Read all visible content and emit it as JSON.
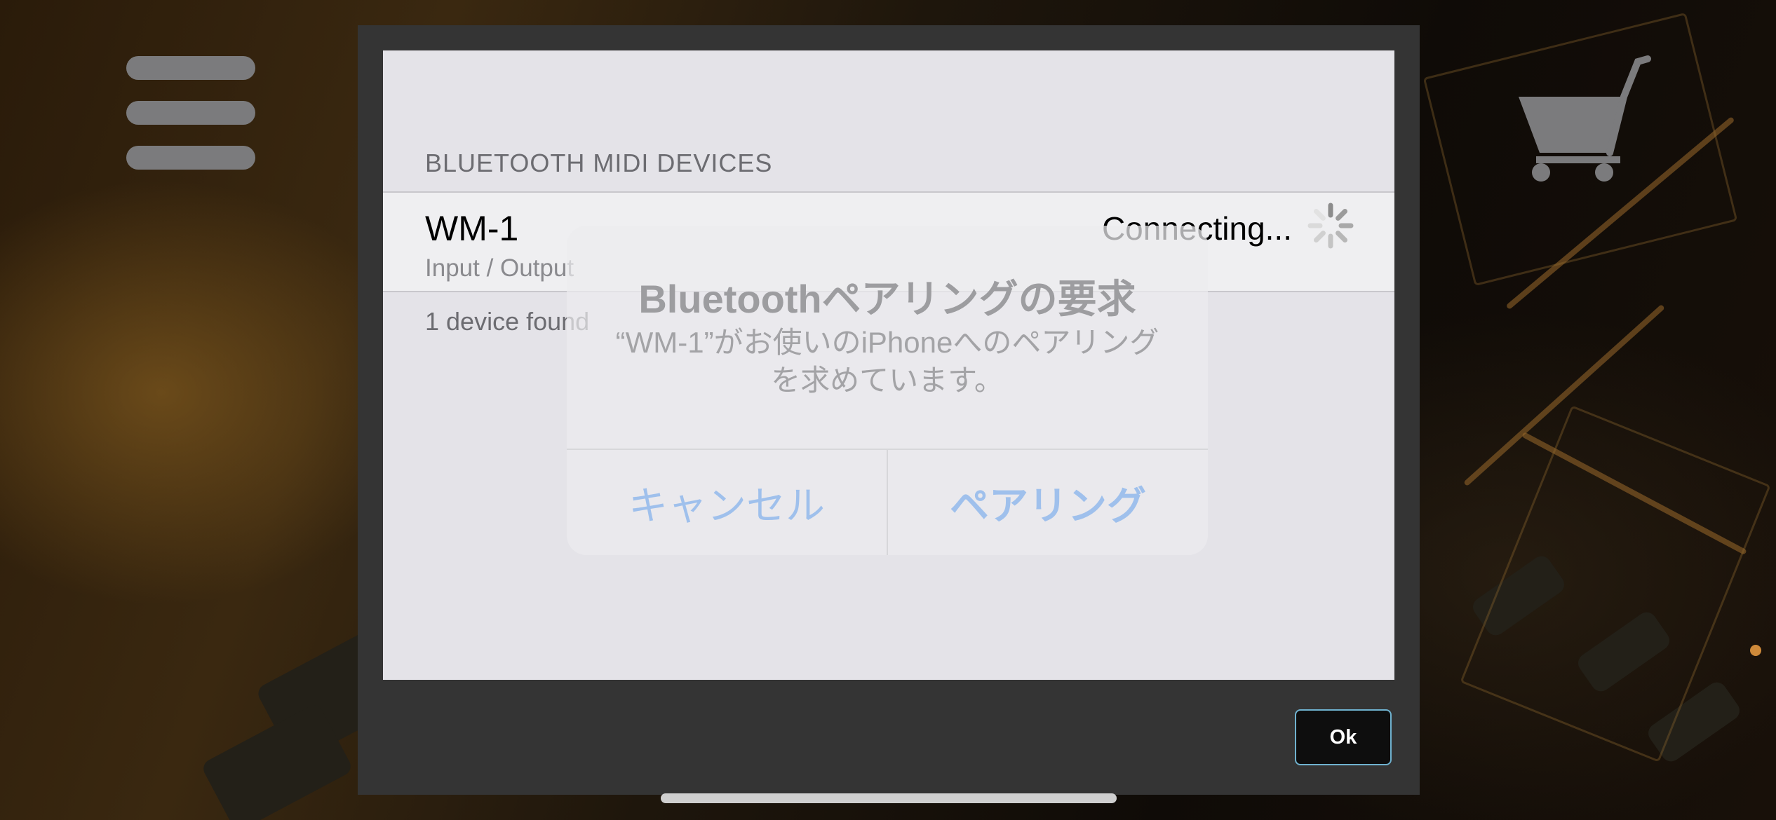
{
  "dialog": {
    "section_header": "BLUETOOTH MIDI DEVICES",
    "device": {
      "name": "WM-1",
      "type": "Input / Output",
      "status": "Connecting..."
    },
    "device_count": "1 device found",
    "ok_label": "Ok"
  },
  "alert": {
    "title": "Bluetoothペアリングの要求",
    "message_line1": "“WM-1”がお使いのiPhoneへのペアリング",
    "message_line2": "を求めています。",
    "cancel_label": "キャンセル",
    "pair_label": "ペアリング"
  },
  "icons": {
    "menu": "hamburger-icon",
    "cart": "cart-icon",
    "spinner": "spinner-icon"
  },
  "colors": {
    "ok_border": "#6fb2cf",
    "alert_button": "#9fc0ec",
    "dialog_frame": "#343434"
  }
}
